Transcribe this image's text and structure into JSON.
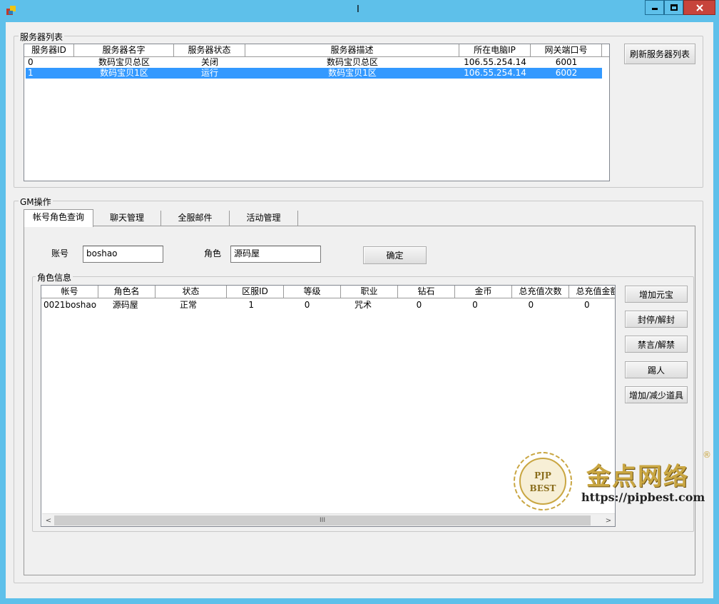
{
  "window": {
    "title": "I",
    "minimize_label": "▁",
    "maximize_label": "□",
    "close_label": "✕",
    "colors": {
      "frame": "#5ec0ea",
      "close": "#c7443b",
      "selection": "#3399ff"
    }
  },
  "server_list": {
    "group_label": "服务器列表",
    "refresh_button": "刷新服务器列表",
    "columns": [
      "服务器ID",
      "服务器名字",
      "服务器状态",
      "服务器描述",
      "所在电脑IP",
      "网关端口号"
    ],
    "rows": [
      [
        "0",
        "数码宝贝总区",
        "关闭",
        "数码宝贝总区",
        "106.55.254.14",
        "6001"
      ],
      [
        "1",
        "数码宝贝1区",
        "运行",
        "数码宝贝1区",
        "106.55.254.14",
        "6002"
      ]
    ],
    "selected_row": 1
  },
  "gm": {
    "group_label": "GM操作",
    "tabs": [
      "帐号角色查询",
      "聊天管理",
      "全服邮件",
      "活动管理"
    ],
    "active_tab": 0,
    "account_label": "账号",
    "account_value": "boshao",
    "role_label": "角色",
    "role_value": "源码屋",
    "confirm_button": "确定",
    "role_info": {
      "group_label": "角色信息",
      "columns": [
        "帐号",
        "角色名",
        "状态",
        "区服ID",
        "等级",
        "职业",
        "钻石",
        "金币",
        "总充值次数",
        "总充值金额"
      ],
      "rows": [
        [
          "0021boshao",
          "源码屋",
          "正常",
          "1",
          "0",
          "咒术",
          "0",
          "0",
          "0",
          "0"
        ]
      ]
    },
    "actions": [
      "增加元宝",
      "封停/解封",
      "禁言/解禁",
      "踢人",
      "增加/减少道具"
    ],
    "scroll_left": "<",
    "scroll_right": ">",
    "scroll_grip": "III"
  },
  "watermark": {
    "badge_line1": "PJP",
    "badge_line2": "BEST",
    "brand": "金点网络",
    "registered": "®",
    "url": "https://pipbest.com"
  }
}
